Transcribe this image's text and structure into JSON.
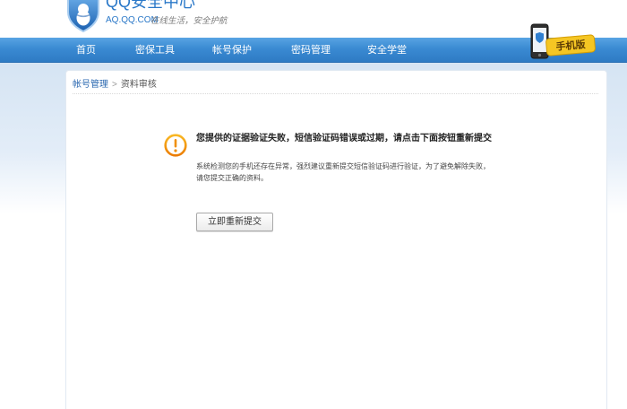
{
  "header": {
    "logo_icon": "qq-shield-logo-icon",
    "logo_title": "QQ安全中心",
    "logo_domain": "AQ.QQ.COM",
    "slogan": "在线生活，安全护航"
  },
  "nav": {
    "items": [
      {
        "label": "首页"
      },
      {
        "label": "密保工具"
      },
      {
        "label": "帐号保护"
      },
      {
        "label": "密码管理"
      },
      {
        "label": "安全学堂"
      }
    ],
    "mobile_icon": "mobile-phone-icon",
    "mobile_label": "手机版"
  },
  "breadcrumb": {
    "parent": "帐号管理",
    "separator": ">",
    "current": "资料审核"
  },
  "notice": {
    "icon": "warning-icon",
    "title": "您提供的证据验证失败，短信验证码错误或过期，请点击下面按钮重新提交",
    "desc_line1": "系统检测您的手机还存在异常，强烈建议重新提交短信验证码进行验证，为了避免解除失败，",
    "desc_line2": "请您提交正确的资料。",
    "button_label": "立即重新提交"
  },
  "colors": {
    "brand_blue": "#2a78c8",
    "nav_blue": "#3a8ad2",
    "link_blue": "#2b68b0",
    "warning_orange": "#f0900a",
    "mobile_sign_yellow": "#f5c623"
  }
}
